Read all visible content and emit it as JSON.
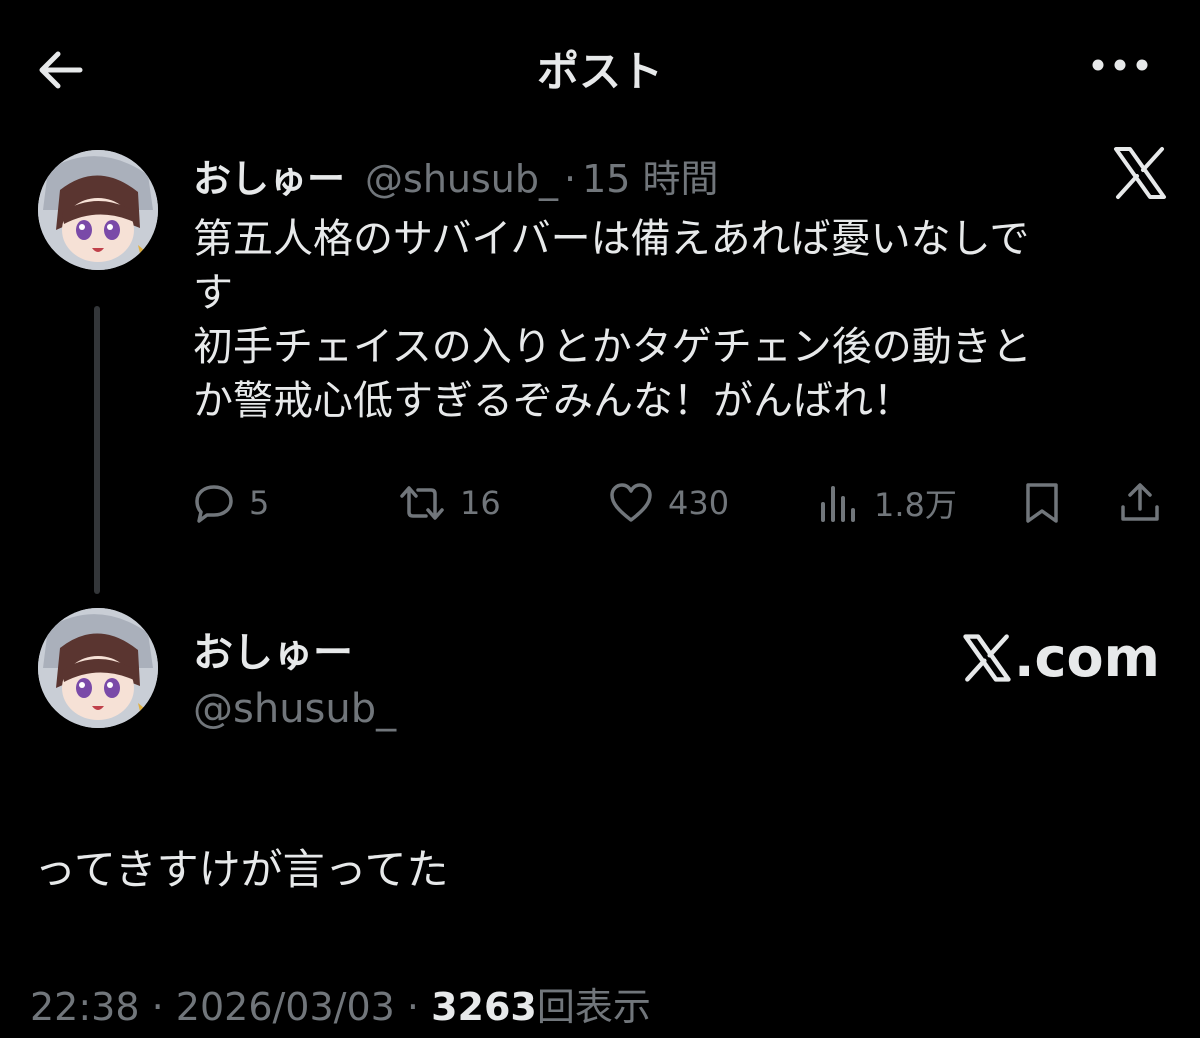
{
  "header": {
    "title": "ポスト",
    "back_icon": "arrow-left-icon",
    "more_icon": "more-horizontal-icon"
  },
  "tweet": {
    "display_name": "おしゅー",
    "handle": "@shusub_",
    "separator": "·",
    "time_ago": "15 時間",
    "body_lines": [
      "第五人格のサバイバーは備えあれば憂いなしで",
      "す",
      "初手チェイスの入りとかタゲチェン後の動きと",
      "か警戒心低すぎるぞみんな！がんばれ！"
    ],
    "actions": {
      "reply_count": "5",
      "retweet_count": "16",
      "like_count": "430",
      "view_count": "1.8万"
    }
  },
  "card": {
    "display_name": "おしゅー",
    "handle": "@shusub_",
    "brand": ".com"
  },
  "quote_text": "ってきすけが言ってた",
  "footer": {
    "time": "22:38",
    "separator": "·",
    "date": "2026/03/03",
    "views": "3263",
    "views_label": "回表示"
  },
  "colors": {
    "background": "#000000",
    "text": "#e7e9ea",
    "muted": "#71767b"
  }
}
